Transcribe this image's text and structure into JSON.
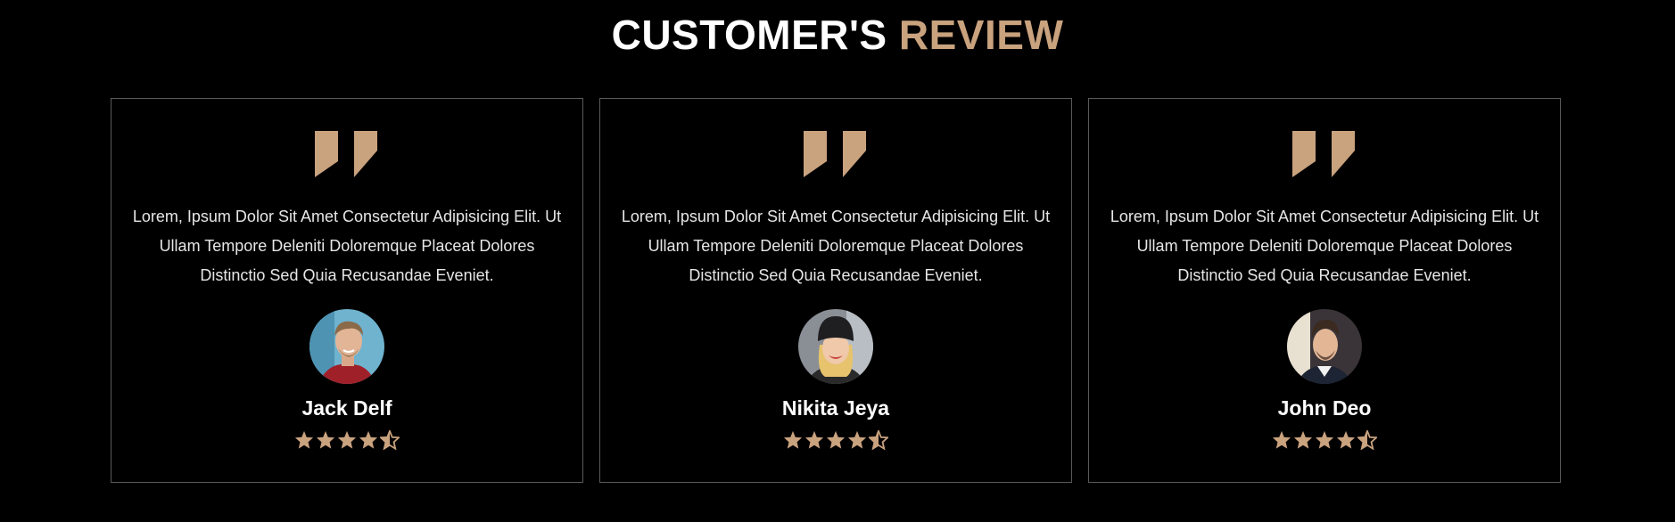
{
  "section": {
    "title_main": "CUSTOMER'S ",
    "title_accent": "REVIEW"
  },
  "colors": {
    "accent": "#c9a27e",
    "background": "#000000",
    "card_border": "#5a5a5a",
    "text": "#e6e6e6"
  },
  "reviews": [
    {
      "text": "Lorem, Ipsum Dolor Sit Amet Consectetur Adipisicing Elit. Ut Ullam Tempore Deleniti Doloremque Placeat Dolores Distinctio Sed Quia Recusandae Eveniet.",
      "name": "Jack Delf",
      "rating": 4.5,
      "rating_max": 5,
      "icon": "quote-icon",
      "avatar": "avatar-photo"
    },
    {
      "text": "Lorem, Ipsum Dolor Sit Amet Consectetur Adipisicing Elit. Ut Ullam Tempore Deleniti Doloremque Placeat Dolores Distinctio Sed Quia Recusandae Eveniet.",
      "name": "Nikita Jeya",
      "rating": 4.5,
      "rating_max": 5,
      "icon": "quote-icon",
      "avatar": "avatar-photo"
    },
    {
      "text": "Lorem, Ipsum Dolor Sit Amet Consectetur Adipisicing Elit. Ut Ullam Tempore Deleniti Doloremque Placeat Dolores Distinctio Sed Quia Recusandae Eveniet.",
      "name": "John Deo",
      "rating": 4.5,
      "rating_max": 5,
      "icon": "quote-icon",
      "avatar": "avatar-photo"
    }
  ]
}
